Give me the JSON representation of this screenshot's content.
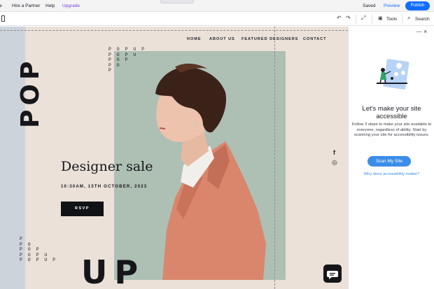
{
  "topbar": {
    "menu": [
      "ite",
      "Hire a Partner",
      "Help",
      "Upgrade"
    ],
    "saved": "Saved",
    "preview": "Preview",
    "publish": "Publish"
  },
  "toolbar": {
    "tools_label": "Tools",
    "search_label": "Search"
  },
  "site": {
    "nav": [
      "HOME",
      "ABOUT US",
      "FEATURED DESIGNERS",
      "CONTACT"
    ],
    "pop_vertical": "POP",
    "pop_stack_top": "P O P U P\nP O P U\nP O P\nP O\nP",
    "pop_stack_bottom": "P\nP O\nP O P\nP O P U\nP O P U P",
    "up_big": "UP",
    "headline": "Designer sale",
    "date_line": "10:30AM, 15TH OCTOBER, 2023",
    "rsvp": "RSVP",
    "social": [
      "f",
      "◎"
    ]
  },
  "panel": {
    "minimize": "—",
    "close": "×",
    "title": "Let's make your site accessible",
    "desc": "Follow 3 steps to make your site available to everyone, regardless of ability. Start by scanning your site for accessibility issues.",
    "scan_button": "Scan My Site",
    "why_link": "Why does accessibility matter?"
  },
  "colors": {
    "accent": "#116dff",
    "panel_button": "#3b8ee8",
    "canvas_bg": "#ebe1d8",
    "mint": "#aebfb4",
    "coat": "#d9866d"
  }
}
